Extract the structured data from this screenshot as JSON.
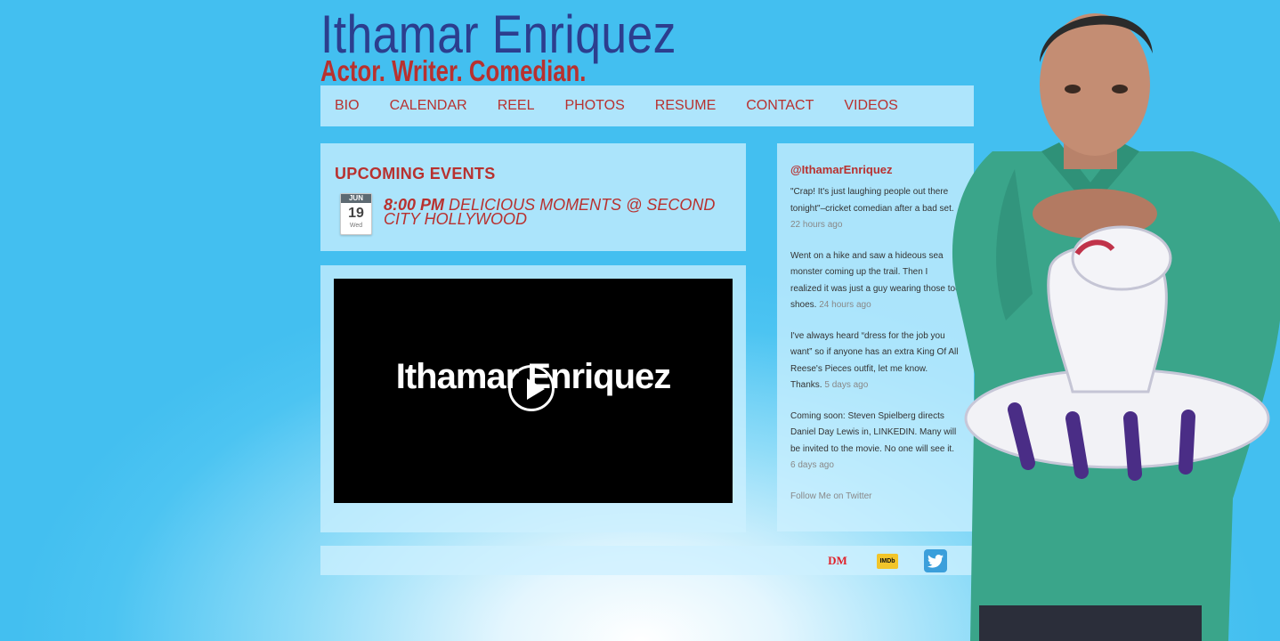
{
  "header": {
    "site_title": "Ithamar Enriquez",
    "tagline": "Actor. Writer. Comedian."
  },
  "nav": {
    "items": [
      "BIO",
      "CALENDAR",
      "REEL",
      "PHOTOS",
      "RESUME",
      "CONTACT",
      "VIDEOS"
    ]
  },
  "events": {
    "heading": "UPCOMING EVENTS",
    "items": [
      {
        "month": "JUN",
        "day": "19",
        "weekday": "Wed",
        "time": "8:00 PM",
        "title": "DELICIOUS MOMENTS @ SECOND CITY HOLLYWOOD"
      }
    ]
  },
  "video": {
    "title_text": "Ithamar Enriquez"
  },
  "twitter": {
    "handle": "@IthamarEnriquez",
    "tweets": [
      {
        "text": "\"Crap! It's just laughing people out there tonight\"–cricket comedian after a bad set.",
        "ago": "22 hours ago"
      },
      {
        "text": "Went on a hike and saw a hideous sea monster coming up the trail. Then I realized it was just a guy wearing those toe shoes.",
        "ago": "24 hours ago"
      },
      {
        "text": "I've always heard “dress for the job you want” so if anyone has an extra King Of All Reese's Pieces outfit, let me know. Thanks.",
        "ago": "5 days ago"
      },
      {
        "text": "Coming soon: Steven Spielberg directs Daniel Day Lewis in, LINKEDIN. Many will be invited to the movie. No one will see it.",
        "ago": "6 days ago"
      }
    ],
    "follow_label": "Follow Me on Twitter"
  },
  "footer": {
    "dm_label": "DM",
    "imdb_label": "IMDb"
  },
  "colors": {
    "accent_red": "#b8312f",
    "title_blue": "#2c3e8e",
    "background_blue": "#43bff0"
  }
}
